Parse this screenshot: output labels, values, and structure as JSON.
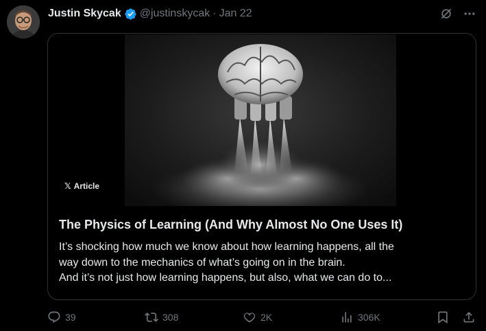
{
  "author": {
    "name": "Justin Skycak",
    "handle": "@justinskycak",
    "separator": "·",
    "date": "Jan 22"
  },
  "card": {
    "badge": "Article",
    "badge_logo": "𝕏",
    "title": "The Physics of Learning (And Why Almost No One Uses It)",
    "desc_line1": "It’s shocking how much we know about how learning happens, all the",
    "desc_line2": "way down to the mechanics of what’s going on in the brain.",
    "desc_line3": "And it’s not just how learning happens, but also, what we can do to..."
  },
  "actions": {
    "replies": "39",
    "reposts": "308",
    "likes": "2K",
    "views": "306K"
  },
  "icons": {
    "verified": "verified-badge-icon",
    "grok": "grok-icon",
    "more": "more-icon",
    "reply": "reply-icon",
    "repost": "repost-icon",
    "like": "like-icon",
    "views": "views-icon",
    "bookmark": "bookmark-icon",
    "share": "share-icon"
  },
  "colors": {
    "background": "#000000",
    "text": "#e7e9ea",
    "muted": "#71767b",
    "border": "#2f3336",
    "verified": "#1d9bf0"
  }
}
